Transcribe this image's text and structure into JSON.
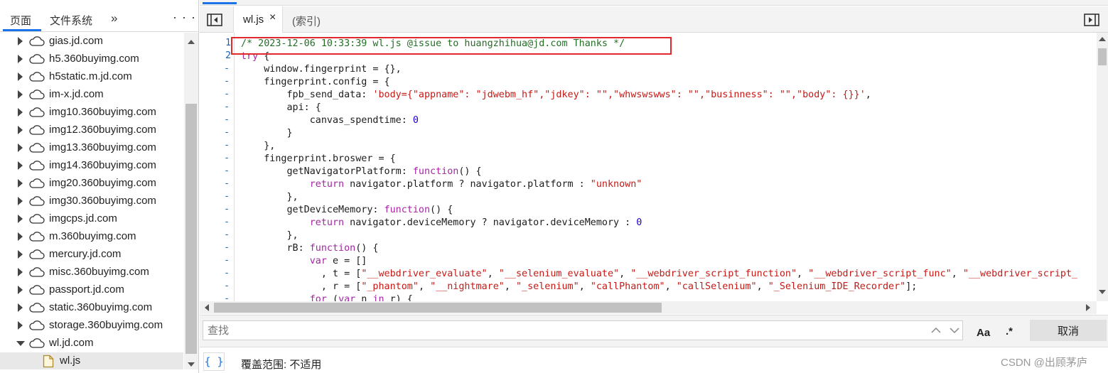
{
  "left_panel": {
    "tabs": {
      "pages": "页面",
      "filesystem": "文件系统",
      "more": "»",
      "menu": "⋮"
    },
    "tree": [
      {
        "label": "gias.jd.com",
        "type": "domain"
      },
      {
        "label": "h5.360buyimg.com",
        "type": "domain"
      },
      {
        "label": "h5static.m.jd.com",
        "type": "domain"
      },
      {
        "label": "im-x.jd.com",
        "type": "domain"
      },
      {
        "label": "img10.360buyimg.com",
        "type": "domain"
      },
      {
        "label": "img12.360buyimg.com",
        "type": "domain"
      },
      {
        "label": "img13.360buyimg.com",
        "type": "domain"
      },
      {
        "label": "img14.360buyimg.com",
        "type": "domain"
      },
      {
        "label": "img20.360buyimg.com",
        "type": "domain"
      },
      {
        "label": "img30.360buyimg.com",
        "type": "domain"
      },
      {
        "label": "imgcps.jd.com",
        "type": "domain"
      },
      {
        "label": "m.360buyimg.com",
        "type": "domain"
      },
      {
        "label": "mercury.jd.com",
        "type": "domain"
      },
      {
        "label": "misc.360buyimg.com",
        "type": "domain"
      },
      {
        "label": "passport.jd.com",
        "type": "domain"
      },
      {
        "label": "static.360buyimg.com",
        "type": "domain"
      },
      {
        "label": "storage.360buyimg.com",
        "type": "domain"
      },
      {
        "label": "wl.jd.com",
        "type": "domain",
        "expanded": true
      },
      {
        "label": "wl.js",
        "type": "file",
        "selected": true
      }
    ]
  },
  "editor": {
    "tabs": [
      {
        "label": "wl.js",
        "active": true,
        "close": "×"
      },
      {
        "label": "(索引)",
        "active": false
      }
    ],
    "gutter": [
      "1",
      "2"
    ],
    "highlight_color": "#e0282e"
  },
  "search": {
    "placeholder": "查找",
    "case_label": "Aa",
    "regex_label": ".*",
    "cancel_label": "取消"
  },
  "status": {
    "pretty_print": "{ }",
    "coverage": "覆盖范围: 不适用",
    "watermark": "CSDN @出顾茅庐"
  },
  "colors": {
    "accent": "#1a73e8",
    "comment": "#236e25",
    "string": "#c41a16",
    "keyword": "#a626a4"
  }
}
